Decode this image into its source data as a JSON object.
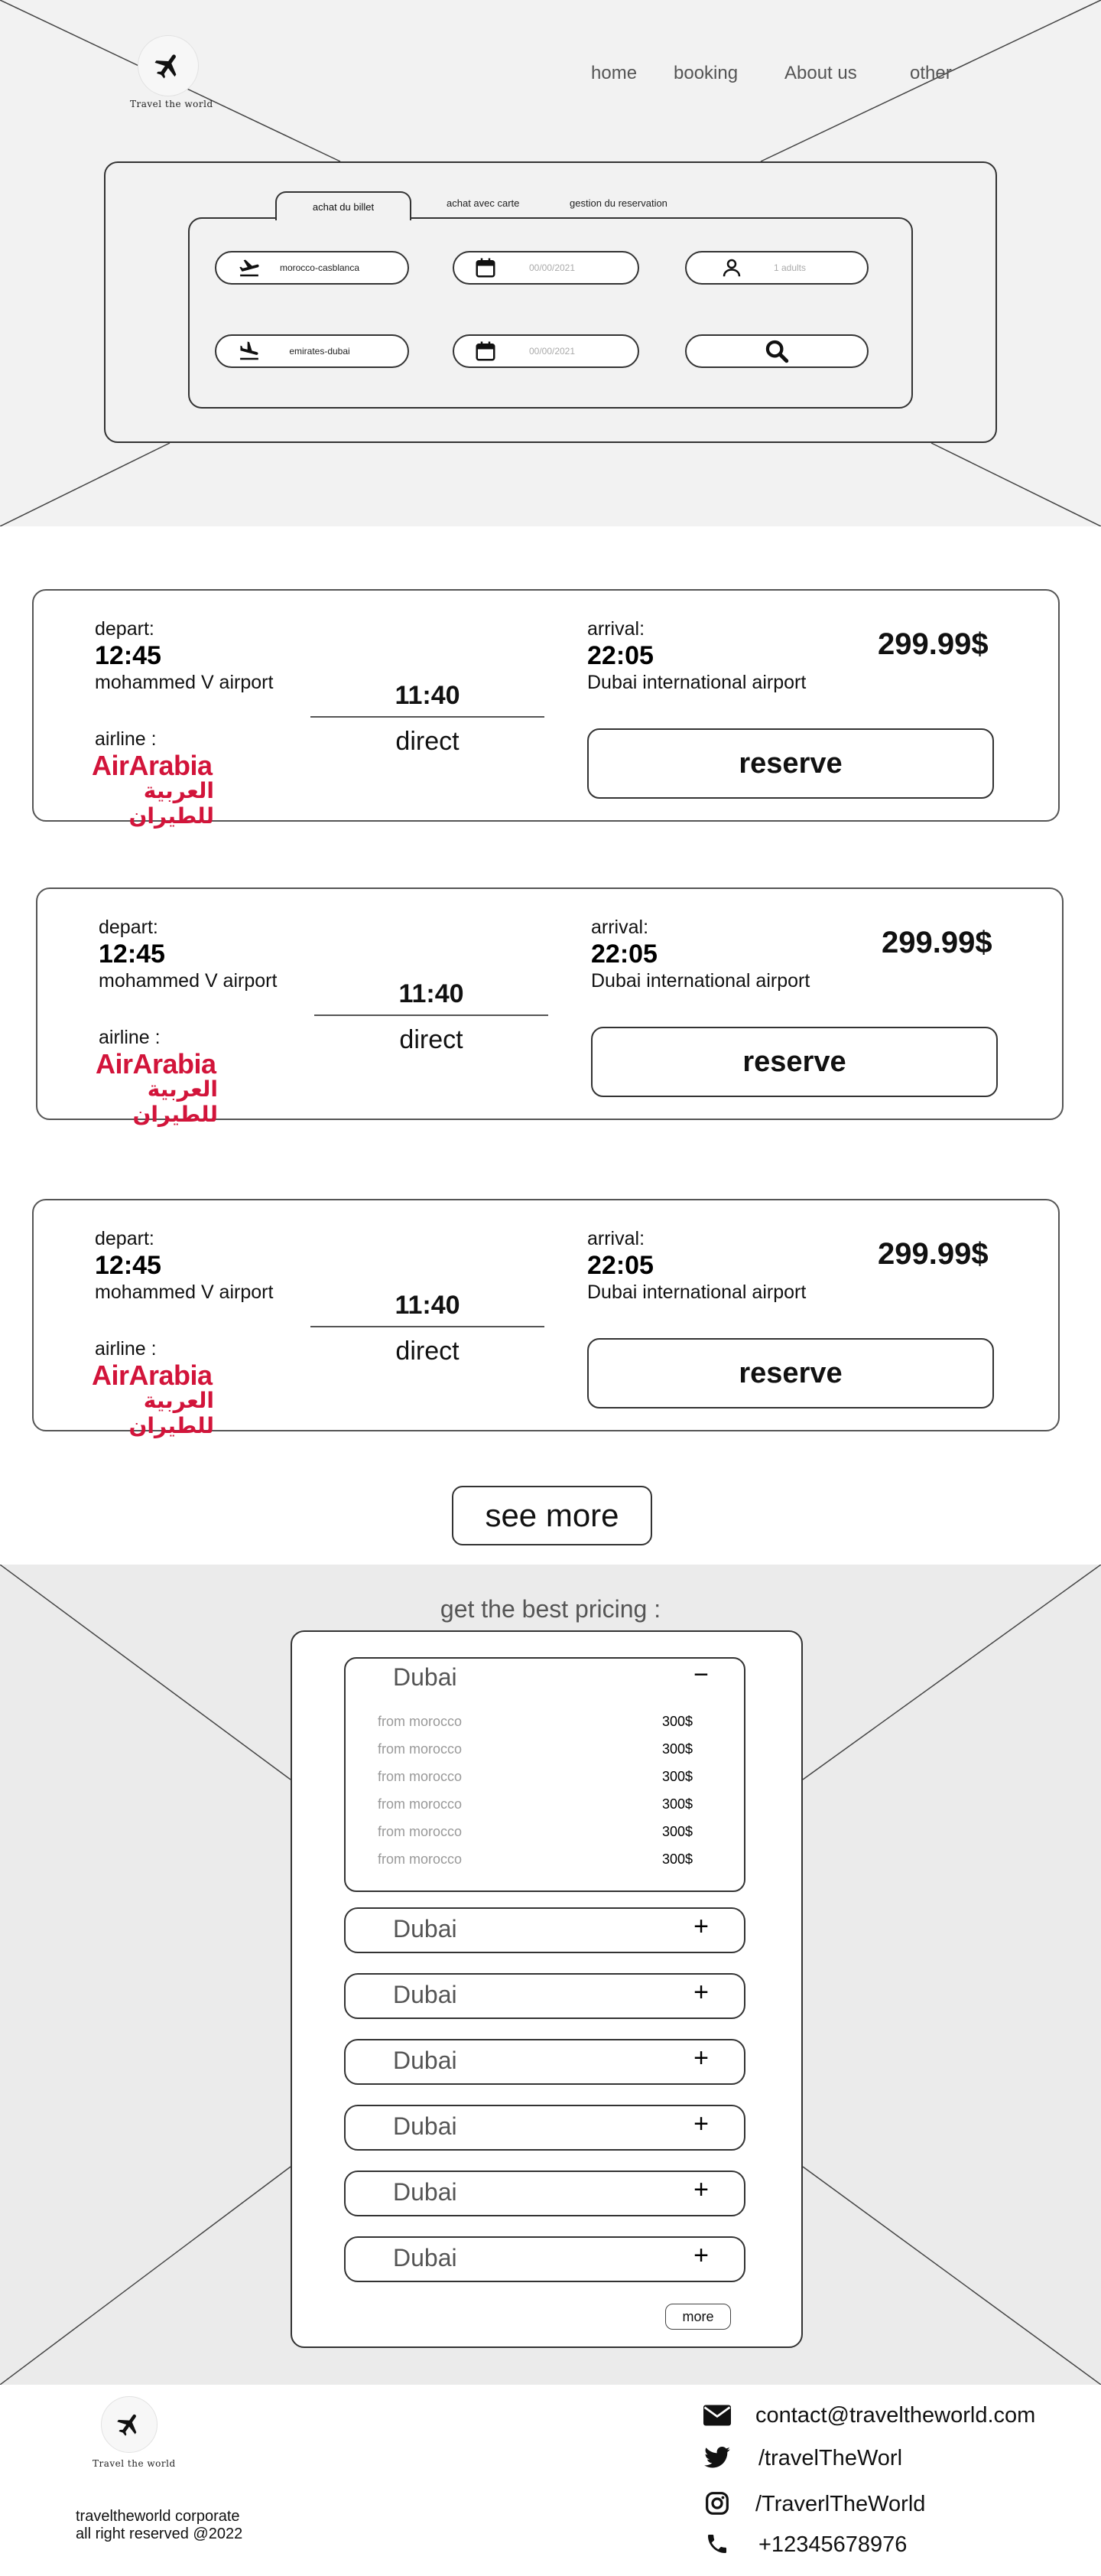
{
  "brand": {
    "logo_text": "Travel the world"
  },
  "nav": {
    "items": [
      "home",
      "booking",
      "About us",
      "other"
    ]
  },
  "search": {
    "tabs": [
      "achat du billet",
      "achat avec carte",
      "gestion du reservation"
    ],
    "from": "morocco-casblanca",
    "to": "emirates-dubai",
    "depart_date_placeholder": "00/00/2021",
    "return_date_placeholder": "00/00/2021",
    "passengers": "1 adults"
  },
  "flights": [
    {
      "depart_label": "depart:",
      "depart_time": "12:45",
      "depart_airport": "mohammed V airport",
      "duration": "11:40",
      "stops": "direct",
      "arrival_label": "arrival:",
      "arrival_time": "22:05",
      "arrival_airport": "Dubai international airport",
      "price": "299.99$",
      "airline_label": "airline :",
      "airline_en": "AirArabia",
      "airline_ar": "العربية للطيران",
      "reserve_label": "reserve"
    },
    {
      "depart_label": "depart:",
      "depart_time": "12:45",
      "depart_airport": "mohammed V airport",
      "duration": "11:40",
      "stops": "direct",
      "arrival_label": "arrival:",
      "arrival_time": "22:05",
      "arrival_airport": "Dubai international airport",
      "price": "299.99$",
      "airline_label": "airline :",
      "airline_en": "AirArabia",
      "airline_ar": "العربية للطيران",
      "reserve_label": "reserve"
    },
    {
      "depart_label": "depart:",
      "depart_time": "12:45",
      "depart_airport": "mohammed V airport",
      "duration": "11:40",
      "stops": "direct",
      "arrival_label": "arrival:",
      "arrival_time": "22:05",
      "arrival_airport": "Dubai international airport",
      "price": "299.99$",
      "airline_label": "airline :",
      "airline_en": "AirArabia",
      "airline_ar": "العربية للطيران",
      "reserve_label": "reserve"
    }
  ],
  "see_more_label": "see more",
  "pricing": {
    "title": "get the best pricing :",
    "open_item": {
      "title": "Dubai",
      "sign": "−",
      "rows": [
        {
          "from": "from morocco",
          "price": "300$"
        },
        {
          "from": "from morocco",
          "price": "300$"
        },
        {
          "from": "from morocco",
          "price": "300$"
        },
        {
          "from": "from morocco",
          "price": "300$"
        },
        {
          "from": "from morocco",
          "price": "300$"
        },
        {
          "from": "from morocco",
          "price": "300$"
        }
      ]
    },
    "closed_items": [
      {
        "title": "Dubai",
        "sign": "+"
      },
      {
        "title": "Dubai",
        "sign": "+"
      },
      {
        "title": "Dubai",
        "sign": "+"
      },
      {
        "title": "Dubai",
        "sign": "+"
      },
      {
        "title": "Dubai",
        "sign": "+"
      },
      {
        "title": "Dubai",
        "sign": "+"
      }
    ],
    "more_label": "more"
  },
  "footer": {
    "logo_text": "Travel the world",
    "corporate": "traveltheworld corporate",
    "rights": "all right reserved @2022",
    "contact": {
      "email": "contact@traveltheworld.com",
      "twitter": "/travelTheWorl",
      "instagram": "/TraverlTheWorld",
      "phone": "+12345678976"
    }
  }
}
